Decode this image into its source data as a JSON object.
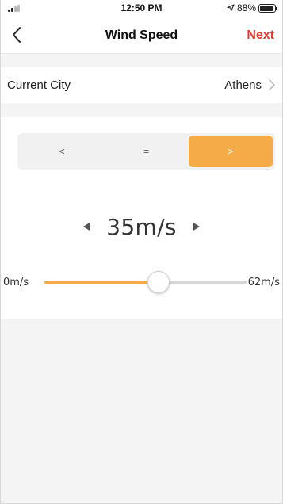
{
  "status_bar": {
    "time": "12:50 PM",
    "battery_text": "88%",
    "battery_level": 0.88
  },
  "nav": {
    "title": "Wind Speed",
    "next_label": "Next"
  },
  "city": {
    "label": "Current City",
    "value": "Athens"
  },
  "comparison": {
    "options": [
      "<",
      "=",
      ">"
    ],
    "selected": ">"
  },
  "wind": {
    "value_text": "35m/s",
    "value": 35,
    "min": 0,
    "max": 62,
    "min_label": "0m/s",
    "max_label": "62m/s"
  },
  "colors": {
    "accent": "#f5ac48",
    "next": "#e23b2e"
  },
  "icons": {
    "back": "chevron-left-icon",
    "city_chevron": "chevron-right-icon",
    "decrease": "triangle-left-icon",
    "increase": "triangle-right-icon"
  }
}
